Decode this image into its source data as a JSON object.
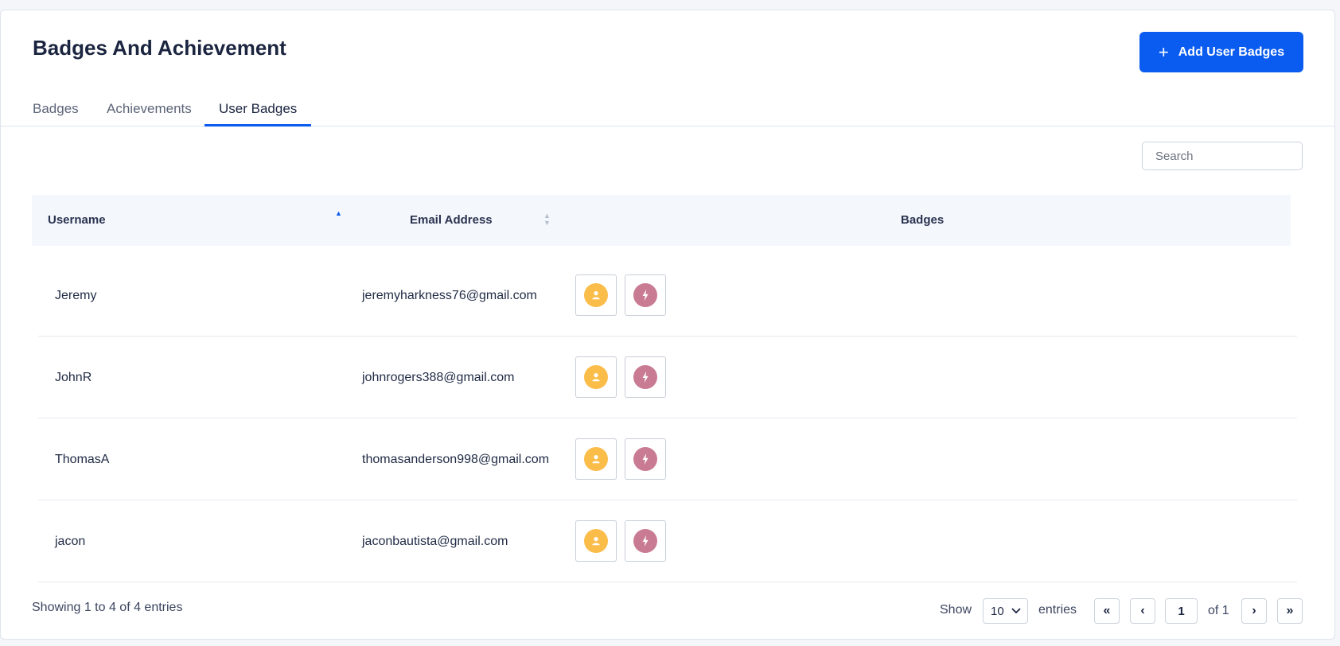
{
  "page": {
    "title": "Badges And Achievement"
  },
  "header": {
    "add_button_label": "Add User Badges"
  },
  "tabs": [
    {
      "label": "Badges",
      "active": false
    },
    {
      "label": "Achievements",
      "active": false
    },
    {
      "label": "User Badges",
      "active": true
    }
  ],
  "search": {
    "placeholder": "Search",
    "value": ""
  },
  "table": {
    "columns": [
      {
        "label": "Username",
        "sort": "ascending"
      },
      {
        "label": "Email Address",
        "sort": "none"
      },
      {
        "label": "Badges"
      }
    ],
    "rows": [
      {
        "username": "Jeremy",
        "email": "jeremyharkness76@gmail.com",
        "badges": [
          "user-icon",
          "lightning-icon"
        ]
      },
      {
        "username": "JohnR",
        "email": "johnrogers388@gmail.com",
        "badges": [
          "user-icon",
          "lightning-icon"
        ]
      },
      {
        "username": "ThomasA",
        "email": "thomasanderson998@gmail.com",
        "badges": [
          "user-icon",
          "lightning-icon"
        ]
      },
      {
        "username": "jacon",
        "email": "jaconbautista@gmail.com",
        "badges": [
          "user-icon",
          "lightning-icon"
        ]
      }
    ]
  },
  "footer": {
    "info": "Showing 1 to 4 of 4 entries",
    "show_label": "Show",
    "entries_value": "10",
    "entries_label": "entries",
    "first_label": "«",
    "prev_label": "‹",
    "current_page": "1",
    "of_label": "of 1",
    "next_label": "›",
    "last_label": "»"
  },
  "colors": {
    "accent": "#0a5cf0",
    "badge_user": "#fbbd4a",
    "badge_lightning": "#c97b93"
  }
}
